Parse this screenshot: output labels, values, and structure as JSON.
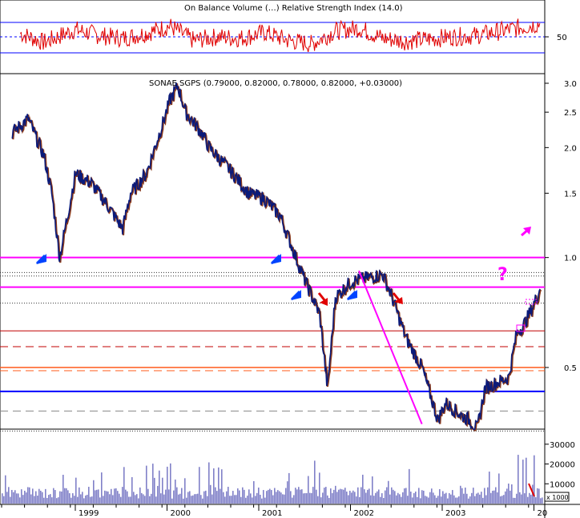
{
  "indicator": {
    "title": "On Balance Volume (…)  Relative Strength Index (14.0)",
    "tick_label": "50"
  },
  "main": {
    "title": "SONAE SGPS (0.79000, 0.82000, 0.78000, 0.82000, +0.03000)"
  },
  "volume": {
    "badge": "x 1000"
  },
  "colors": {
    "price": "#0a1a7a",
    "price_shadow": "#8b3a1a",
    "rsi": "#e00000",
    "magenta": "#ff00ff",
    "orange": "#ff5a1a",
    "blue_line": "#0000ff",
    "dashed_red": "#c00000",
    "volume": "#8080c8",
    "arrow_blue": "#0044ff",
    "arrow_red": "#e00000"
  },
  "annotations": {
    "question_mark": "?"
  },
  "chart_data": [
    {
      "type": "line",
      "title": "On Balance Volume / Relative Strength Index (14.0)",
      "series": [
        {
          "x": [
            "1998-06",
            "1998-09",
            "1999-01",
            "1999-04",
            "1999-07",
            "1999-10",
            "2000-01",
            "2000-04",
            "2000-07",
            "2000-10",
            "2001-01",
            "2001-04",
            "2001-07",
            "2001-10",
            "2002-01",
            "2002-04",
            "2002-07",
            "2002-10",
            "2003-01",
            "2003-04",
            "2003-07",
            "2003-10",
            "2003-12"
          ],
          "values": [
            55,
            42,
            60,
            52,
            48,
            55,
            65,
            45,
            50,
            48,
            56,
            45,
            40,
            58,
            62,
            48,
            44,
            47,
            50,
            52,
            58,
            64,
            68
          ]
        }
      ],
      "reference_lines": [
        70,
        50,
        30
      ],
      "yticks": [
        "50"
      ]
    },
    {
      "type": "line",
      "title": "SONAE SGPS (0.79000, 0.82000, 0.78000, 0.82000, +0.03000)",
      "yscale": "log",
      "ylim": [
        0.3,
        3.2
      ],
      "yticks": [
        "3.0",
        "2.5",
        "2.0",
        "1.5",
        "1.0",
        "0.5"
      ],
      "xticks": [
        "1999",
        "2000",
        "2001",
        "2002",
        "2003",
        "20"
      ],
      "series": [
        {
          "x": [
            "1998-05",
            "1998-07",
            "1998-09",
            "1998-10",
            "1998-11",
            "1998-12",
            "1999-01",
            "1999-03",
            "1999-05",
            "1999-07",
            "1999-08",
            "1999-10",
            "1999-12",
            "2000-01",
            "2000-02",
            "2000-03",
            "2000-05",
            "2000-06",
            "2000-09",
            "2000-11",
            "2001-01",
            "2001-03",
            "2001-05",
            "2001-06",
            "2001-08",
            "2001-09",
            "2001-10",
            "2001-12",
            "2002-02",
            "2002-04",
            "2002-05",
            "2002-07",
            "2002-09",
            "2002-11",
            "2002-12",
            "2003-02",
            "2003-03",
            "2003-04",
            "2003-05",
            "2003-07",
            "2003-08",
            "2003-09",
            "2003-10",
            "2003-11",
            "2003-12"
          ],
          "values": [
            2.2,
            2.4,
            1.9,
            1.5,
            1.0,
            1.3,
            1.7,
            1.6,
            1.4,
            1.2,
            1.5,
            1.7,
            2.3,
            2.7,
            2.95,
            2.5,
            2.2,
            2.0,
            1.7,
            1.5,
            1.45,
            1.3,
            1.0,
            0.88,
            0.7,
            0.44,
            0.78,
            0.86,
            0.88,
            0.9,
            0.8,
            0.6,
            0.5,
            0.36,
            0.4,
            0.37,
            0.36,
            0.34,
            0.44,
            0.46,
            0.47,
            0.62,
            0.66,
            0.73,
            0.82
          ]
        }
      ],
      "horizontal_lines": [
        {
          "value": 1.0,
          "style": "magenta"
        },
        {
          "value": 0.91,
          "style": "dotted"
        },
        {
          "value": 0.89,
          "style": "dotted"
        },
        {
          "value": 0.83,
          "style": "magenta"
        },
        {
          "value": 0.75,
          "style": "dotted"
        },
        {
          "value": 0.63,
          "style": "red"
        },
        {
          "value": 0.57,
          "style": "dashed-red"
        },
        {
          "value": 0.5,
          "style": "orange"
        },
        {
          "value": 0.49,
          "style": "dashed-orange"
        },
        {
          "value": 0.43,
          "style": "blue"
        },
        {
          "value": 0.38,
          "style": "dashed-grey"
        },
        {
          "value": 0.335,
          "style": "dotted"
        }
      ],
      "trendline": {
        "from": [
          "2002-01",
          0.92
        ],
        "to": [
          "2002-09",
          0.35
        ]
      }
    },
    {
      "type": "bar",
      "title": "Volume",
      "ylabel": "x 1000",
      "yticks": [
        "30000",
        "20000",
        "10000"
      ],
      "ylim": [
        0,
        36000
      ]
    }
  ]
}
